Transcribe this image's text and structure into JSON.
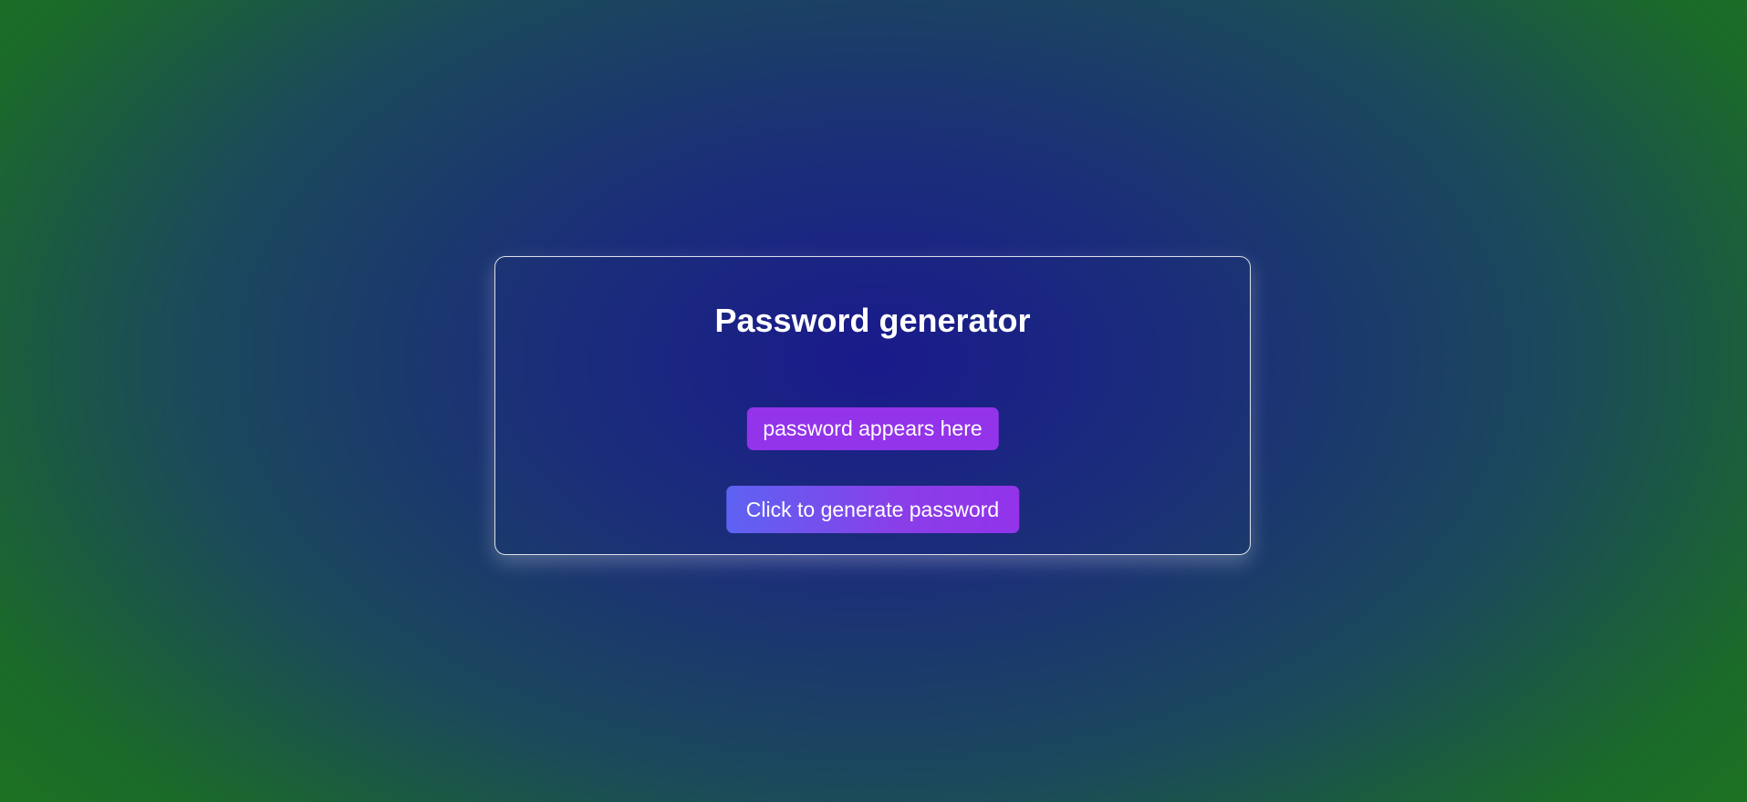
{
  "card": {
    "title": "Password generator",
    "output_text": "password appears here",
    "generate_button_label": "Click to generate password"
  }
}
